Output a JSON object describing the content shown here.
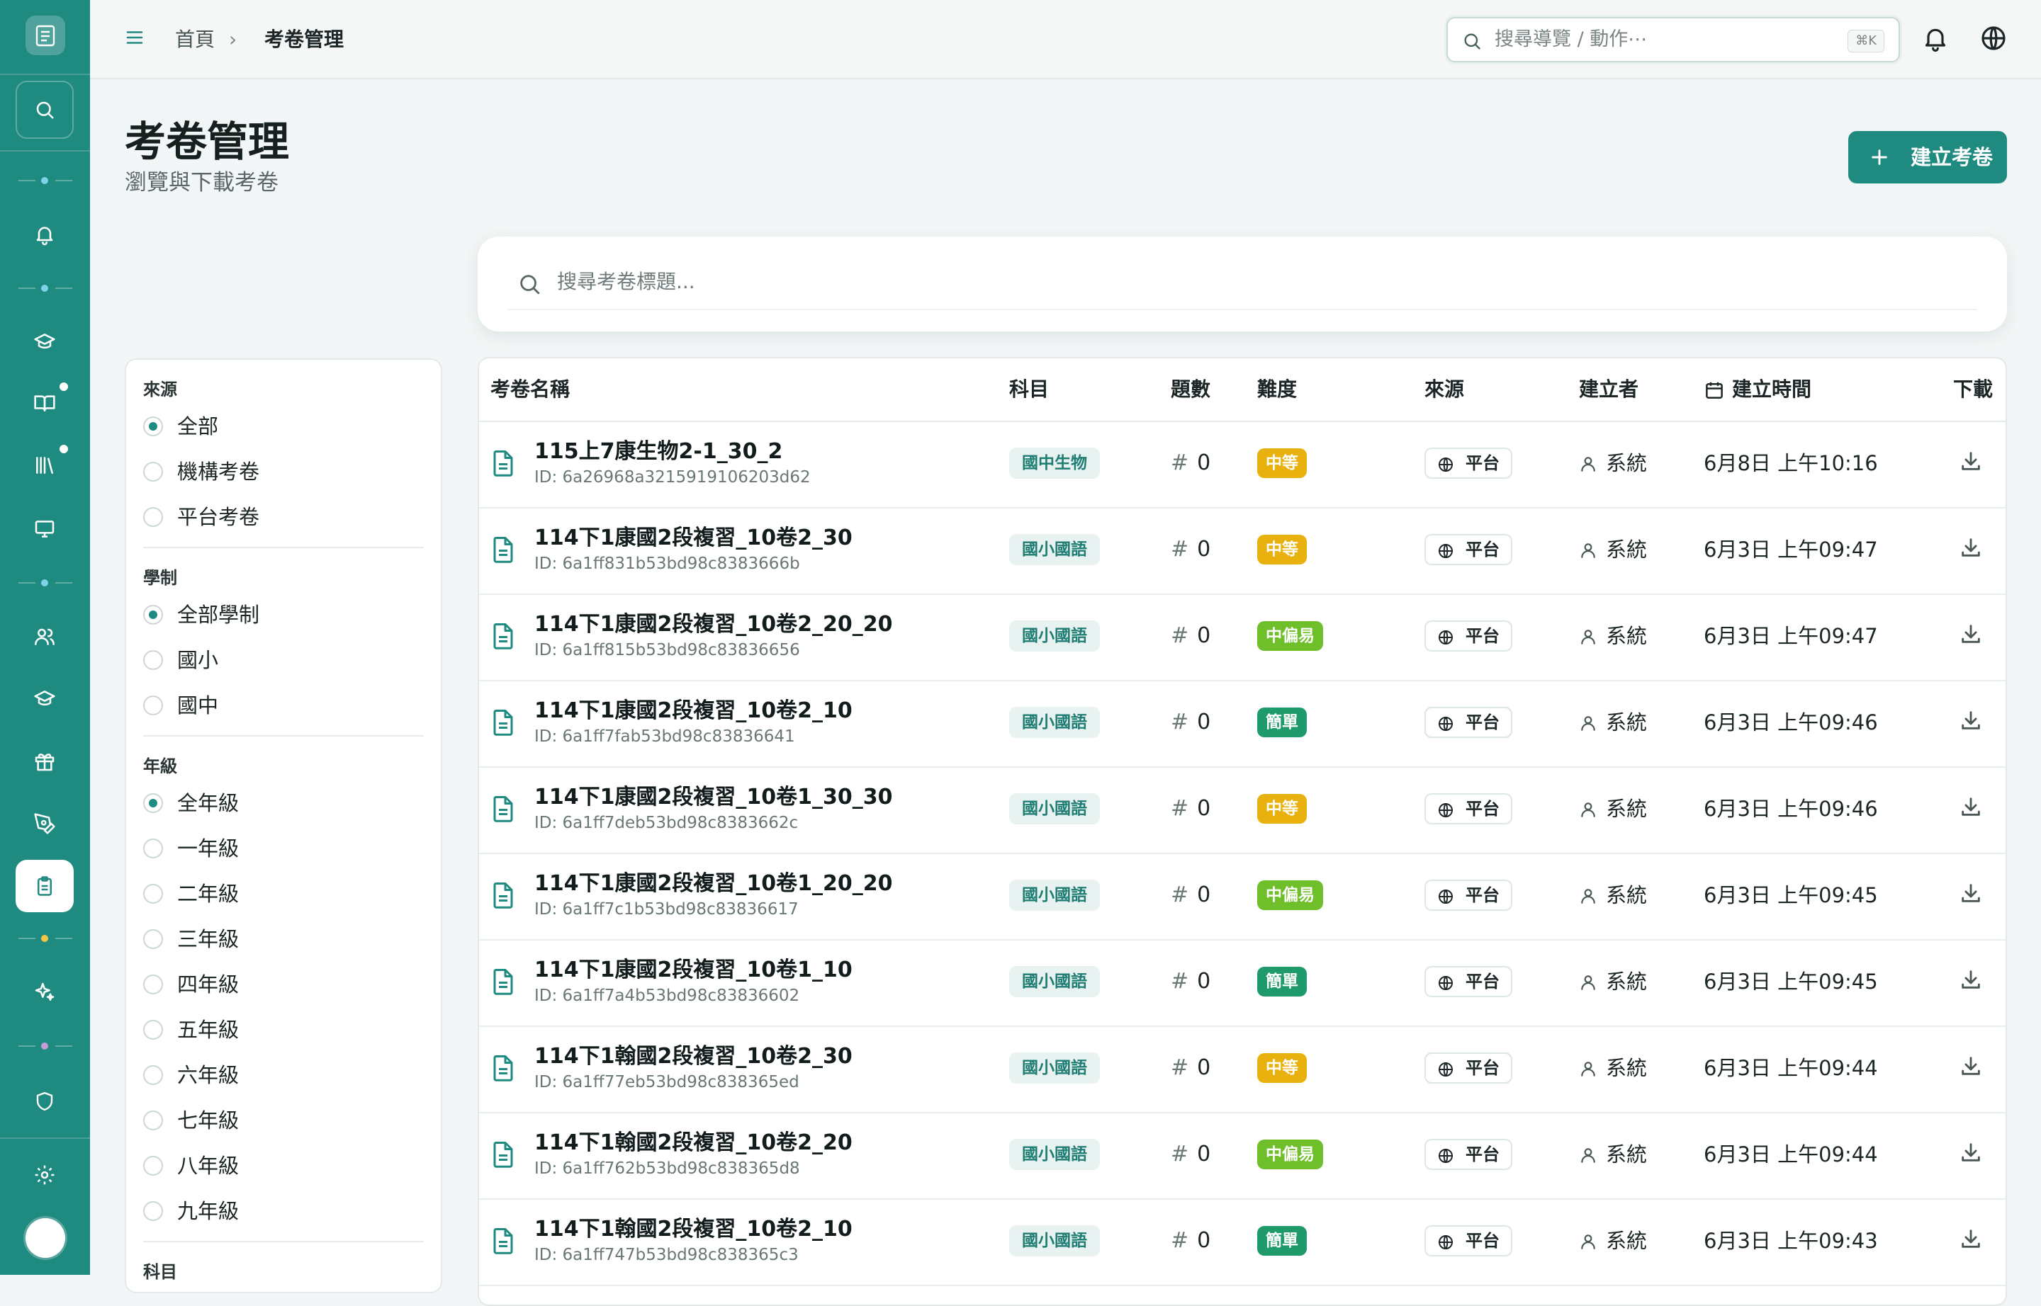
{
  "breadcrumb": {
    "home": "首頁",
    "separator": "›",
    "current": "考卷管理"
  },
  "top_search": {
    "placeholder": "搜尋導覽 / 動作⋯",
    "shortcut": "⌘K"
  },
  "page": {
    "title": "考卷管理",
    "subtitle": "瀏覽與下載考卷",
    "create_label": "建立考卷"
  },
  "search": {
    "placeholder": "搜尋考卷標題..."
  },
  "filters": {
    "source": {
      "label": "來源",
      "options": [
        "全部",
        "機構考卷",
        "平台考卷"
      ],
      "selected": "全部"
    },
    "system": {
      "label": "學制",
      "options": [
        "全部學制",
        "國小",
        "國中"
      ],
      "selected": "全部學制"
    },
    "grade": {
      "label": "年級",
      "options": [
        "全年級",
        "一年級",
        "二年級",
        "三年級",
        "四年級",
        "五年級",
        "六年級",
        "七年級",
        "八年級",
        "九年級"
      ],
      "selected": "全年級"
    },
    "subject": {
      "label": "科目"
    }
  },
  "table": {
    "headers": {
      "name": "考卷名稱",
      "subject": "科目",
      "count": "題數",
      "difficulty": "難度",
      "source": "來源",
      "creator": "建立者",
      "created": "建立時間",
      "download": "下載"
    },
    "rows": [
      {
        "name": "115上7康生物2-1_30_2",
        "id": "ID: 6a26968a3215919106203d62",
        "subject": "國中生物",
        "count": "0",
        "difficulty": "中等",
        "source": "平台",
        "creator": "系統",
        "created": "6月8日 上午10:16"
      },
      {
        "name": "114下1康國2段複習_10卷2_30",
        "id": "ID: 6a1ff831b53bd98c8383666b",
        "subject": "國小國語",
        "count": "0",
        "difficulty": "中等",
        "source": "平台",
        "creator": "系統",
        "created": "6月3日 上午09:47"
      },
      {
        "name": "114下1康國2段複習_10卷2_20_20",
        "id": "ID: 6a1ff815b53bd98c83836656",
        "subject": "國小國語",
        "count": "0",
        "difficulty": "中偏易",
        "source": "平台",
        "creator": "系統",
        "created": "6月3日 上午09:47"
      },
      {
        "name": "114下1康國2段複習_10卷2_10",
        "id": "ID: 6a1ff7fab53bd98c83836641",
        "subject": "國小國語",
        "count": "0",
        "difficulty": "簡單",
        "source": "平台",
        "creator": "系統",
        "created": "6月3日 上午09:46"
      },
      {
        "name": "114下1康國2段複習_10卷1_30_30",
        "id": "ID: 6a1ff7deb53bd98c8383662c",
        "subject": "國小國語",
        "count": "0",
        "difficulty": "中等",
        "source": "平台",
        "creator": "系統",
        "created": "6月3日 上午09:46"
      },
      {
        "name": "114下1康國2段複習_10卷1_20_20",
        "id": "ID: 6a1ff7c1b53bd98c83836617",
        "subject": "國小國語",
        "count": "0",
        "difficulty": "中偏易",
        "source": "平台",
        "creator": "系統",
        "created": "6月3日 上午09:45"
      },
      {
        "name": "114下1康國2段複習_10卷1_10",
        "id": "ID: 6a1ff7a4b53bd98c83836602",
        "subject": "國小國語",
        "count": "0",
        "difficulty": "簡單",
        "source": "平台",
        "creator": "系統",
        "created": "6月3日 上午09:45"
      },
      {
        "name": "114下1翰國2段複習_10卷2_30",
        "id": "ID: 6a1ff77eb53bd98c838365ed",
        "subject": "國小國語",
        "count": "0",
        "difficulty": "中等",
        "source": "平台",
        "creator": "系統",
        "created": "6月3日 上午09:44"
      },
      {
        "name": "114下1翰國2段複習_10卷2_20",
        "id": "ID: 6a1ff762b53bd98c838365d8",
        "subject": "國小國語",
        "count": "0",
        "difficulty": "中偏易",
        "source": "平台",
        "creator": "系統",
        "created": "6月3日 上午09:44"
      },
      {
        "name": "114下1翰國2段複習_10卷2_10",
        "id": "ID: 6a1ff747b53bd98c838365c3",
        "subject": "國小國語",
        "count": "0",
        "difficulty": "簡單",
        "source": "平台",
        "creator": "系統",
        "created": "6月3日 上午09:43"
      }
    ]
  },
  "colors": {
    "brand": "#1f8a80",
    "difficulty_medium": "#e9b10d",
    "difficulty_medium_easy": "#6fbf2a",
    "difficulty_easy": "#1f9a6a"
  },
  "icons": {
    "sidebar": [
      "logo-icon",
      "search-icon",
      "bell-icon",
      "graduation-cap-icon",
      "book-icon",
      "library-icon",
      "monitor-icon",
      "users-icon",
      "graduation-cap-icon",
      "gift-icon",
      "pen-tool-icon",
      "clipboard-icon",
      "sparkles-icon",
      "shield-icon",
      "gear-icon"
    ],
    "row": [
      "document-icon",
      "hash-icon",
      "globe-icon",
      "user-icon",
      "download-icon"
    ]
  }
}
